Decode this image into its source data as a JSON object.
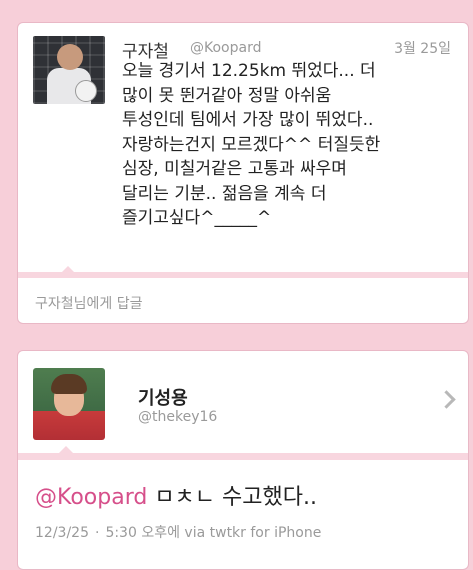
{
  "tweet1": {
    "author": "구자철",
    "handle": "@Koopard",
    "date": "3월 25일",
    "lines": [
      "오늘 경기서 12.25km 뛰었다... 더",
      "많이 못 뛴거같아 정말 아쉬움",
      "투성인데 팀에서 가장 많이 뛰었다..",
      "자랑하는건지 모르겠다^^ 터질듯한",
      "심장, 미칠거같은 고통과 싸우며",
      "달리는 기분.. 젊음을 계속 더",
      "즐기고싶다^_____^"
    ],
    "reply_placeholder": "구자철님에게 답글"
  },
  "tweet2": {
    "author": "기성용",
    "handle": "@thekey16",
    "mention": "@Koopard",
    "text": " ㅁㅊㄴ 수고했다..",
    "date": "12/3/25",
    "separator": "·",
    "time": "5:30 오후에",
    "via": "via twtkr for iPhone"
  },
  "colors": {
    "page_background": "#f7cfd9",
    "mention": "#d64f8a",
    "muted_text": "#9a9a9a"
  },
  "icons": {
    "profile_chevron": "chevron-right-icon"
  }
}
